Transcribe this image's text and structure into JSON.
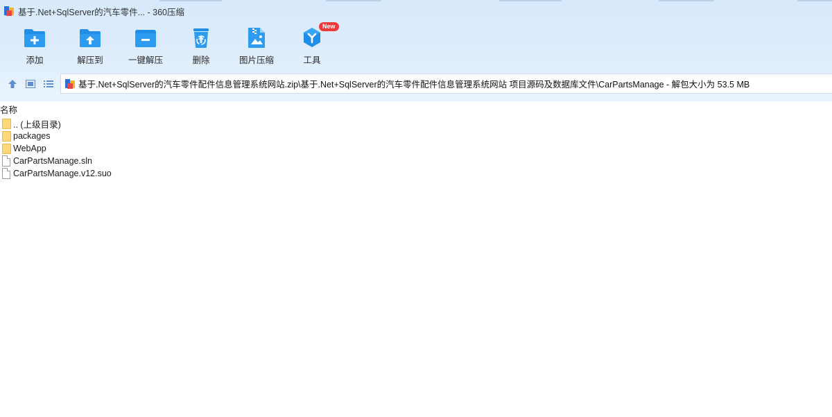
{
  "window": {
    "title": "基于.Net+SqlServer的汽车零件... - 360压缩"
  },
  "toolbar": {
    "buttons": [
      {
        "label": "添加",
        "icon": "add-folder-icon"
      },
      {
        "label": "解压到",
        "icon": "extract-to-icon"
      },
      {
        "label": "一键解压",
        "icon": "one-click-extract-icon"
      },
      {
        "label": "删除",
        "icon": "recycle-bin-icon"
      },
      {
        "label": "图片压缩",
        "icon": "image-compress-icon"
      },
      {
        "label": "工具",
        "icon": "tools-icon",
        "badge": "New"
      }
    ]
  },
  "nav": {
    "icons": [
      "up-arrow-icon",
      "thumbnail-view-icon",
      "list-view-icon"
    ],
    "address": "基于.Net+SqlServer的汽车零件配件信息管理系统网站.zip\\基于.Net+SqlServer的汽车零件配件信息管理系统网站 项目源码及数据库文件\\CarPartsManage - 解包大小为 53.5 MB"
  },
  "list": {
    "column_name": "名称",
    "items": [
      {
        "name": ".. (上级目录)",
        "type": "folder"
      },
      {
        "name": "packages",
        "type": "folder"
      },
      {
        "name": "WebApp",
        "type": "folder"
      },
      {
        "name": "CarPartsManage.sln",
        "type": "file"
      },
      {
        "name": "CarPartsManage.v12.suo",
        "type": "file"
      }
    ]
  },
  "colors": {
    "accent": "#1e8ee6",
    "chrome_bg": "#dcecfc",
    "badge": "#f0393b",
    "folder": "#fcd878"
  }
}
